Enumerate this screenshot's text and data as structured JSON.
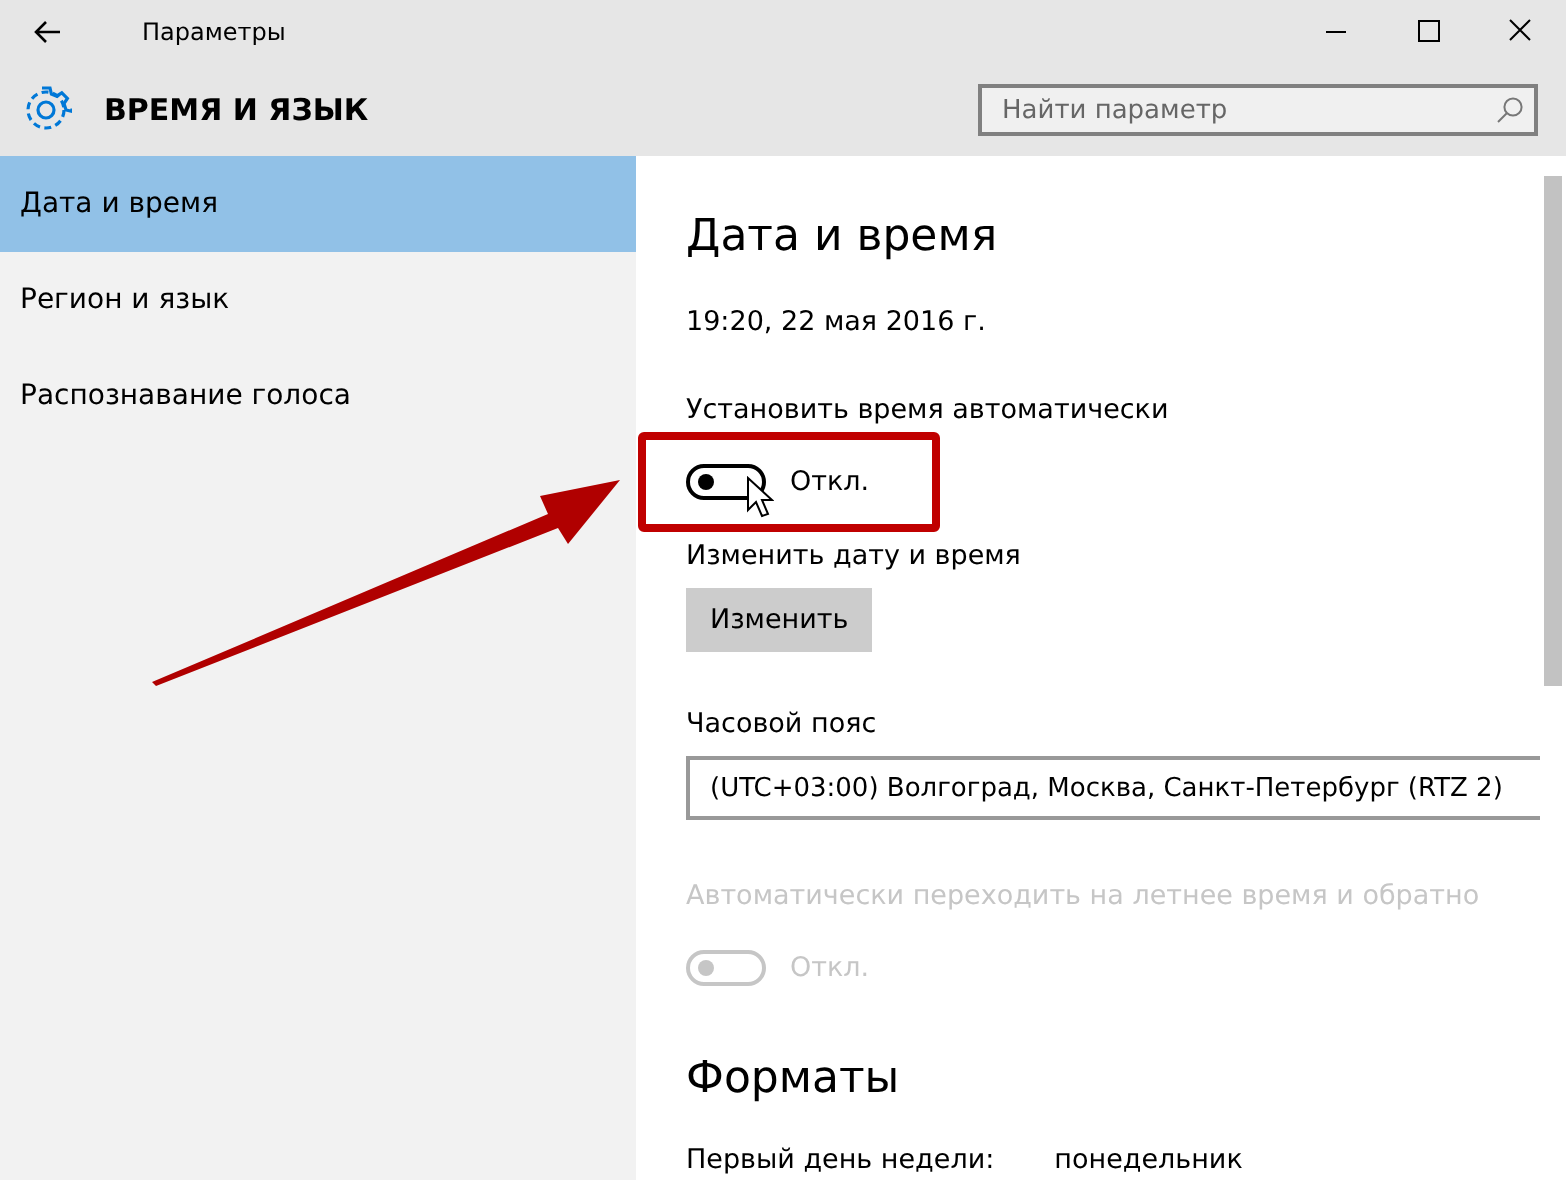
{
  "window": {
    "title": "Параметры"
  },
  "header": {
    "title": "ВРЕМЯ И ЯЗЫК",
    "search": {
      "placeholder": "Найти параметр"
    }
  },
  "sidebar": {
    "items": [
      {
        "label": "Дата и время",
        "selected": true
      },
      {
        "label": "Регион и язык",
        "selected": false
      },
      {
        "label": "Распознавание голоса",
        "selected": false
      }
    ]
  },
  "content": {
    "heading": "Дата и время",
    "current_time": "19:20, 22 мая 2016 г.",
    "auto_time": {
      "label": "Установить время автоматически",
      "on": false,
      "disabled": false,
      "state_text": "Откл.",
      "highlighted": true
    },
    "change_label": "Изменить дату и время",
    "change_button": "Изменить",
    "timezone_label": "Часовой пояс",
    "timezone_value": "(UTC+03:00) Волгоград, Москва, Санкт-Петербург (RTZ 2)",
    "dst": {
      "label": "Автоматически переходить на летнее время и обратно",
      "on": false,
      "disabled": true,
      "state_text": "Откл."
    },
    "formats_heading": "Форматы",
    "first_day": {
      "label": "Первый день недели:",
      "value": "понедельник"
    }
  }
}
